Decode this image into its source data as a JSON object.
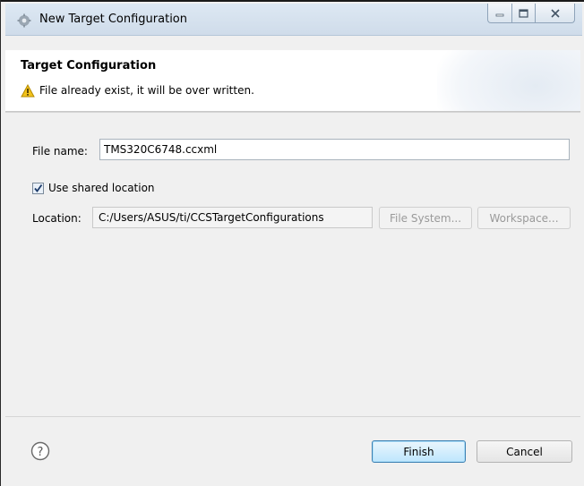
{
  "window": {
    "title": "New Target Configuration",
    "minimize_glyph": "—",
    "close_glyph": "✕"
  },
  "header": {
    "title": "Target Configuration",
    "message": "File already exist, it will be over written.",
    "message_icon": "warning-icon"
  },
  "form": {
    "file_name_label": "File name:",
    "file_name_value": "TMS320C6748.ccxml",
    "shared_checkbox_label": "Use shared location",
    "shared_checked": true,
    "location_label": "Location:",
    "location_value": "C:/Users/ASUS/ti/CCSTargetConfigurations",
    "file_system_button": "File System...",
    "workspace_button": "Workspace..."
  },
  "footer": {
    "help_glyph": "?",
    "finish_button": "Finish",
    "cancel_button": "Cancel"
  },
  "colors": {
    "titlebar": "#d6e2ee",
    "primary_button_border": "#3c7fb1",
    "warning": "#f2c21b"
  }
}
